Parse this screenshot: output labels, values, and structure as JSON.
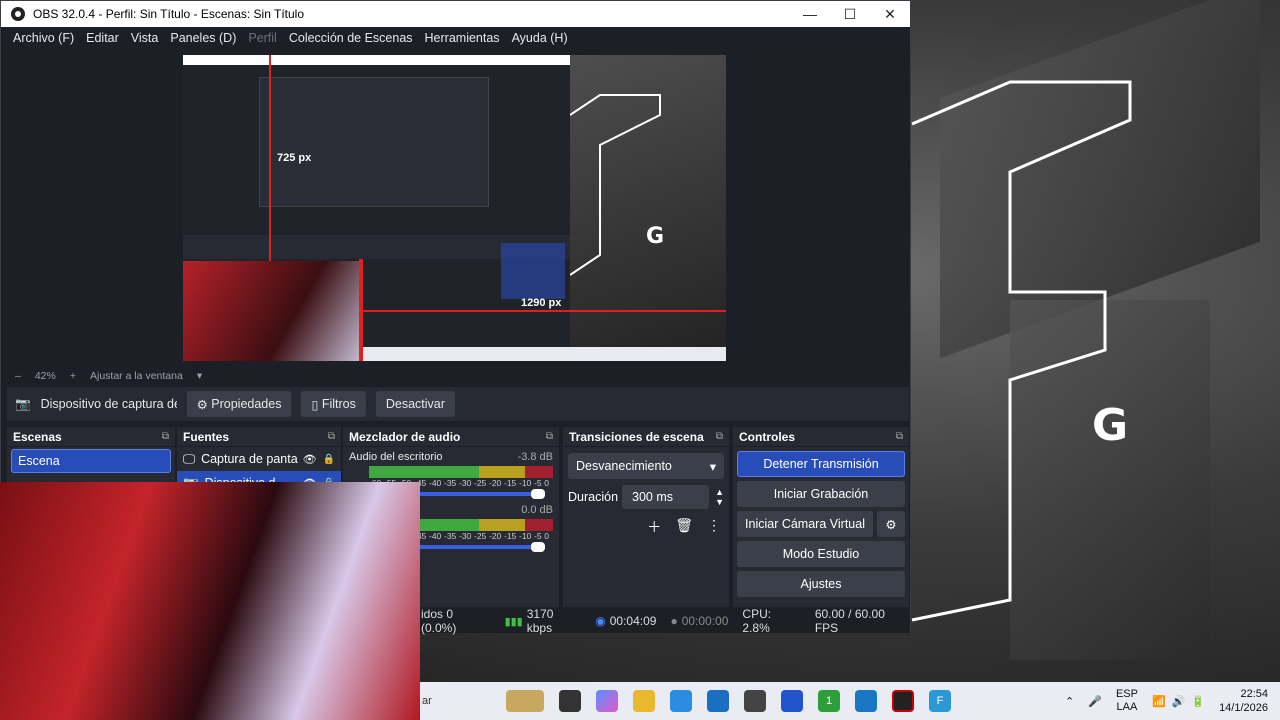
{
  "window": {
    "title": "OBS 32.0.4 - Perfil: Sin Título - Escenas: Sin Título",
    "minimize_glyph": "—",
    "maximize_glyph": "☐",
    "close_glyph": "✕"
  },
  "menu": [
    "Archivo (F)",
    "Editar",
    "Vista",
    "Paneles (D)",
    "Perfil",
    "Colección de Escenas",
    "Herramientas",
    "Ayuda (H)"
  ],
  "preview": {
    "inner_label_top": "725 px",
    "inner_label_bottom": "1290 px"
  },
  "zoom": {
    "value": "42%",
    "minus": "–",
    "plus": "+",
    "fit_label": "Ajustar a la ventana"
  },
  "source_toolbar": {
    "source_name": "Dispositivo de captura de v",
    "properties": "Propiedades",
    "filters": "Filtros",
    "deactivate": "Desactivar"
  },
  "scenes": {
    "title": "Escenas",
    "items": [
      "Escena"
    ]
  },
  "sources": {
    "title": "Fuentes",
    "items": [
      "Captura de panta",
      "Dispositivo d"
    ]
  },
  "mixer": {
    "title": "Mezclador de audio",
    "channels": [
      {
        "name": "Audio del escritorio",
        "db": "-3.8 dB"
      },
      {
        "name": "",
        "db": "0.0 dB"
      }
    ],
    "ticks": [
      "-60",
      "-55",
      "-50",
      "-45",
      "-40",
      "-35",
      "-30",
      "-25",
      "-20",
      "-15",
      "-10",
      "-5",
      "0"
    ]
  },
  "transitions": {
    "title": "Transiciones de escena",
    "selected": "Desvanecimiento",
    "duration_label": "Duración",
    "duration_value": "300 ms"
  },
  "controls": {
    "title": "Controles",
    "stop_stream": "Detener Transmisión",
    "start_recording": "Iniciar Grabación",
    "start_virtual_cam": "Iniciar Cámara Virtual",
    "studio_mode": "Modo Estudio",
    "settings": "Ajustes"
  },
  "status": {
    "dropped": "idos 0 (0.0%)",
    "bitrate": "3170 kbps",
    "stream_time": "00:04:09",
    "rec_time": "00:00:00",
    "cpu": "CPU: 2.8%",
    "fps": "60.00 / 60.00 FPS"
  },
  "taskbar": {
    "search_fragment": "ar",
    "lang_top": "ESP",
    "lang_bottom": "LAA",
    "time": "22:54",
    "date": "14/1/2026",
    "badge": "1"
  },
  "colors": {
    "accent": "#284cb8",
    "panel": "#272a33",
    "background": "#1d1f26"
  }
}
